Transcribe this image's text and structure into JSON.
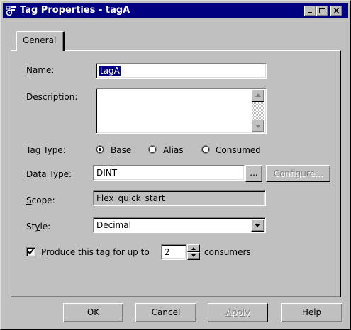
{
  "window": {
    "title": "Tag Properties - tagA",
    "icon": "tag-properties-icon",
    "controls": [
      "minimize-icon",
      "maximize-icon",
      "close-icon"
    ]
  },
  "tabs": [
    {
      "label": "General",
      "selected": true
    }
  ],
  "form": {
    "name": {
      "label": "Name:",
      "value": "tagA"
    },
    "description": {
      "label": "Description:",
      "value": ""
    },
    "tag_type": {
      "label": "Tag Type:",
      "options": [
        "Base",
        "Alias",
        "Consumed"
      ],
      "selected": "Base"
    },
    "data_type": {
      "label": "Data Type:",
      "value": "DINT",
      "browse_label": "...",
      "configure_label": "Configure..."
    },
    "scope": {
      "label": "Scope:",
      "value": "Flex_quick_start"
    },
    "style": {
      "label": "Style:",
      "value": "Decimal"
    },
    "produce": {
      "checked": true,
      "label_before": "Produce this tag for up to",
      "consumers": "2",
      "label_after": "consumers"
    }
  },
  "buttons": {
    "ok": "OK",
    "cancel": "Cancel",
    "apply": "Apply",
    "help": "Help"
  },
  "colors": {
    "titlebar": "#000080",
    "face": "#c0c0c0",
    "selection": "#000080"
  }
}
